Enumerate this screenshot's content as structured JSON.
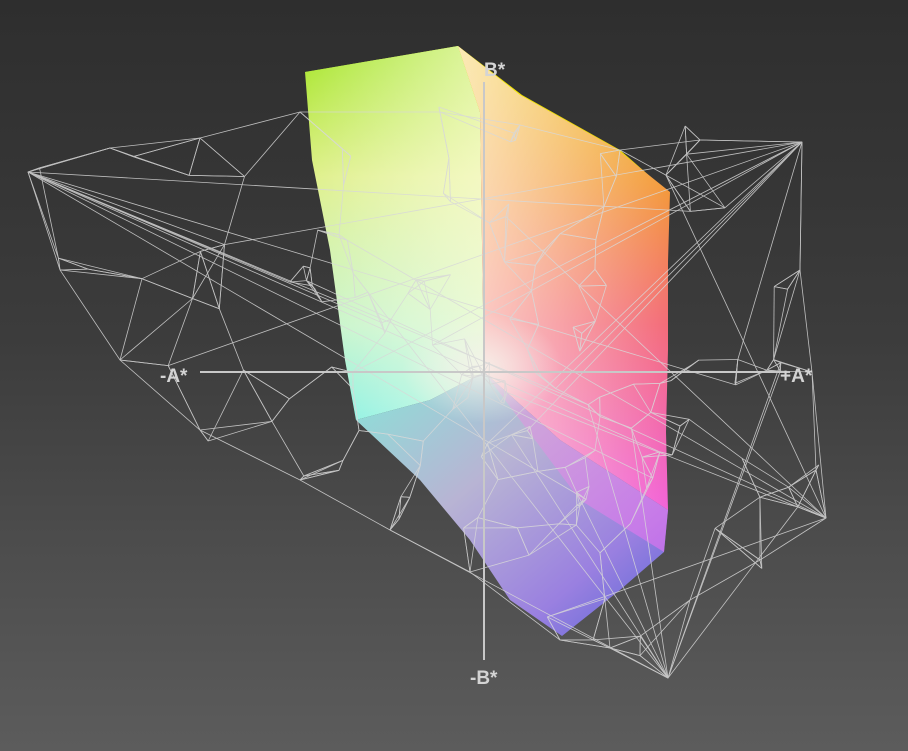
{
  "axes": {
    "b_plus": "B*",
    "b_minus": "-B*",
    "a_minus": "-A*",
    "a_plus": "+A*"
  },
  "colors": {
    "wireframe": "#d8d8d8",
    "axis": "#c8c8c8",
    "yellow": "#f2e400",
    "green": "#8fe020",
    "orange": "#f07a2a",
    "red": "#f04e70",
    "magenta": "#f070f0",
    "cyan": "#7ff0e0",
    "blue": "#5060d8",
    "white": "#f4f0ea"
  }
}
